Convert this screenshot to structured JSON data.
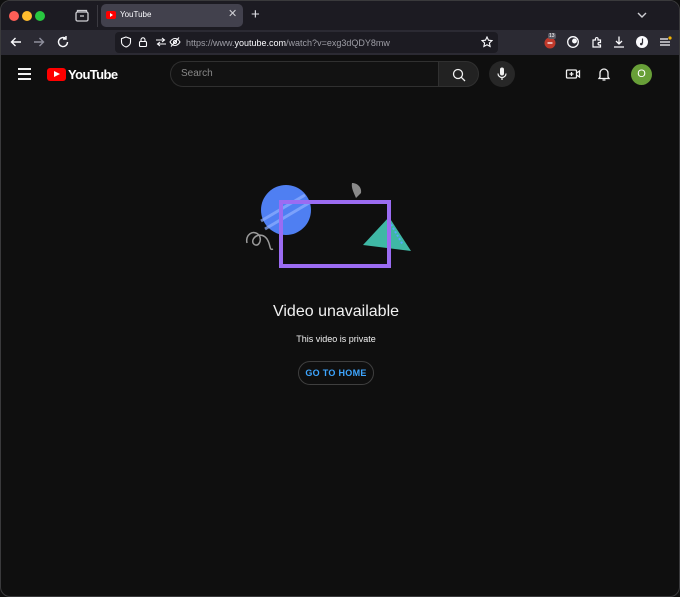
{
  "browser": {
    "tab": {
      "title": "YouTube"
    },
    "url": {
      "prefix": "https://www.",
      "host": "youtube.com",
      "path": "/watch?v=exg3dQDY8mw"
    },
    "extension_badge": "13",
    "icons": [
      "folder-icon",
      "back-icon",
      "forward-icon",
      "reload-icon",
      "shield-icon",
      "lock-icon",
      "permissions-icon",
      "tracking-icon",
      "bookmark-star-icon",
      "extension-icon",
      "profile-icon",
      "extensions-icon",
      "download-icon",
      "music-icon",
      "menu-icon"
    ]
  },
  "youtube": {
    "logo_text": "YouTube",
    "search": {
      "placeholder": "Search"
    },
    "avatar_initial": "O",
    "accent": "#3ea6ff",
    "brand": "#ff0000"
  },
  "error": {
    "title": "Video unavailable",
    "message": "This video is private",
    "home_button": "GO TO HOME"
  }
}
